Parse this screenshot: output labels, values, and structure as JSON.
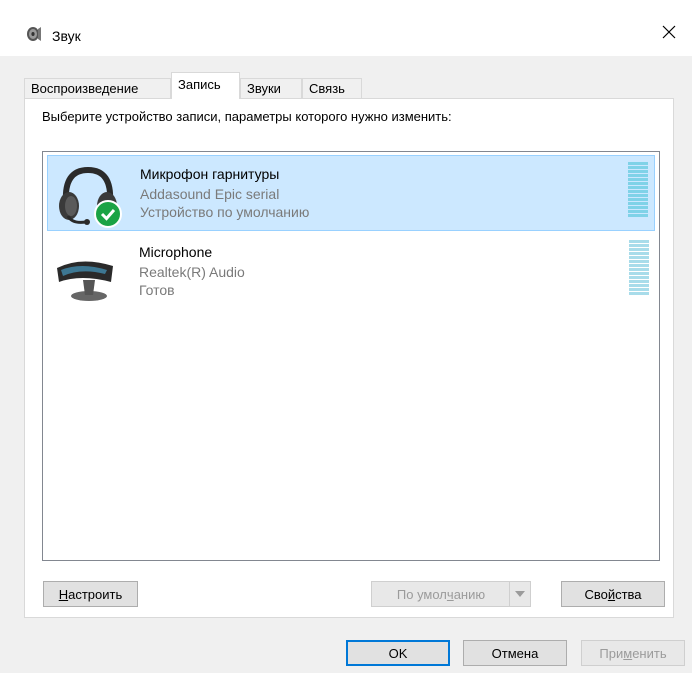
{
  "window": {
    "title": "Звук"
  },
  "tabs": [
    {
      "label": "Воспроизведение",
      "active": false
    },
    {
      "label": "Запись",
      "active": true
    },
    {
      "label": "Звуки",
      "active": false
    },
    {
      "label": "Связь",
      "active": false
    }
  ],
  "instruction": "Выберите устройство записи, параметры которого нужно изменить:",
  "devices": [
    {
      "name": "Микрофон гарнитуры",
      "driver": "Addasound Epic serial",
      "status": "Устройство по умолчанию",
      "icon": "headset-icon",
      "selected": true,
      "is_default": true
    },
    {
      "name": "Microphone",
      "driver": "Realtek(R) Audio",
      "status": "Готов",
      "icon": "webcam-microphone-icon",
      "selected": false,
      "is_default": false
    }
  ],
  "buttons": {
    "configure": {
      "pre": "",
      "ul": "Н",
      "post": "астроить"
    },
    "set_default": {
      "pre": "По умол",
      "ul": "ч",
      "post": "анию"
    },
    "properties": {
      "pre": "Сво",
      "ul": "й",
      "post": "ства"
    },
    "ok": "OK",
    "cancel": "Отмена",
    "apply": {
      "pre": "При",
      "ul": "м",
      "post": "енить"
    }
  },
  "colors": {
    "selection": "#cce8ff",
    "selection_border": "#99d1ff",
    "focus": "#0078d7",
    "default_badge": "#1ba345"
  }
}
